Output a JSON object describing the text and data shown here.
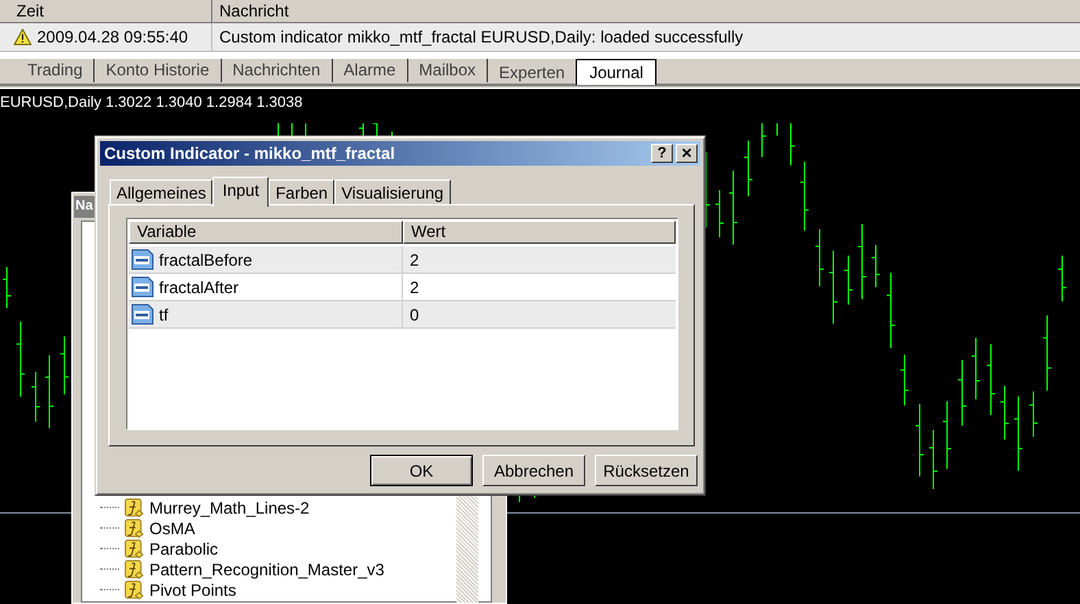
{
  "journal": {
    "columns": [
      "Zeit",
      "Nachricht"
    ],
    "rows": [
      {
        "kind": "warning",
        "time": "2009.04.28 09:55:40",
        "message": "Custom indicator mikko_mtf_fractal EURUSD,Daily: loaded successfully"
      }
    ],
    "tabs": [
      {
        "label": "Trading",
        "selected": false
      },
      {
        "label": "Konto Historie",
        "selected": false
      },
      {
        "label": "Nachrichten",
        "selected": false
      },
      {
        "label": "Alarme",
        "selected": false
      },
      {
        "label": "Mailbox",
        "selected": false
      },
      {
        "label": "Experten",
        "selected": false
      },
      {
        "label": "Journal",
        "selected": true
      }
    ]
  },
  "chart": {
    "label": "EURUSD,Daily  1.3022 1.3040 1.2984 1.3038"
  },
  "navigator": {
    "title": "Na",
    "items": [
      "Murrey_Math_Lines-2",
      "OsMA",
      "Parabolic",
      "Pattern_Recognition_Master_v3",
      "Pivot Points"
    ]
  },
  "dialog": {
    "title": "Custom Indicator - mikko_mtf_fractal",
    "help": "?",
    "close": "×",
    "tabs": [
      {
        "label": "Allgemeines",
        "selected": false
      },
      {
        "label": "Input",
        "selected": true
      },
      {
        "label": "Farben",
        "selected": false
      },
      {
        "label": "Visualisierung",
        "selected": false
      }
    ],
    "columns": [
      "Variable",
      "Wert"
    ],
    "rows": [
      {
        "variable": "fractalBefore",
        "value": "2"
      },
      {
        "variable": "fractalAfter",
        "value": "2"
      },
      {
        "variable": "tf",
        "value": "0"
      }
    ],
    "buttons": [
      {
        "label": "OK",
        "default": true
      },
      {
        "label": "Abbrechen",
        "default": false
      },
      {
        "label": "Rücksetzen",
        "default": false
      }
    ]
  }
}
